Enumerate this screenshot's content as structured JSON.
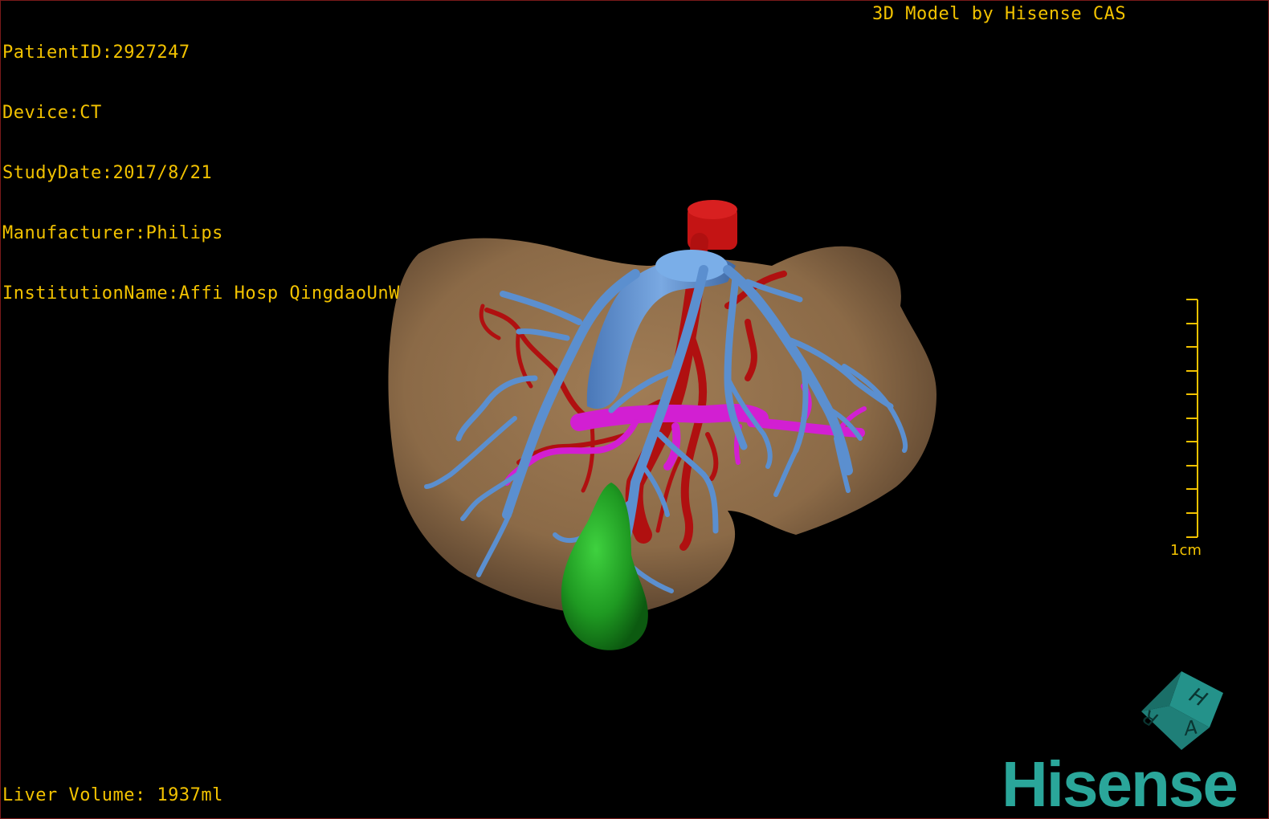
{
  "header": {
    "patient_id": "PatientID:2927247",
    "device": "Device:CT",
    "study_date": "StudyDate:2017/8/21",
    "manufacturer": "Manufacturer:Philips",
    "institution": "InstitutionName:Affi Hosp QingdaoUnW",
    "credit": "3D Model by Hisense CAS"
  },
  "footer": {
    "liver_volume": "Liver Volume: 1937ml"
  },
  "scale_bar": {
    "label": "1cm",
    "color": "#f2c200"
  },
  "orientation_cube": {
    "faces": [
      "H",
      "R",
      "A"
    ],
    "color": "#1f7f78"
  },
  "brand": {
    "name": "Hisense",
    "color": "#2aa69a"
  },
  "model_colors": {
    "liver": "#8b6a47",
    "hepatic_vein": "#5b8fcf",
    "artery": "#b01010",
    "portal_vein": "#d21fd2",
    "gallbladder": "#1f9a22"
  }
}
